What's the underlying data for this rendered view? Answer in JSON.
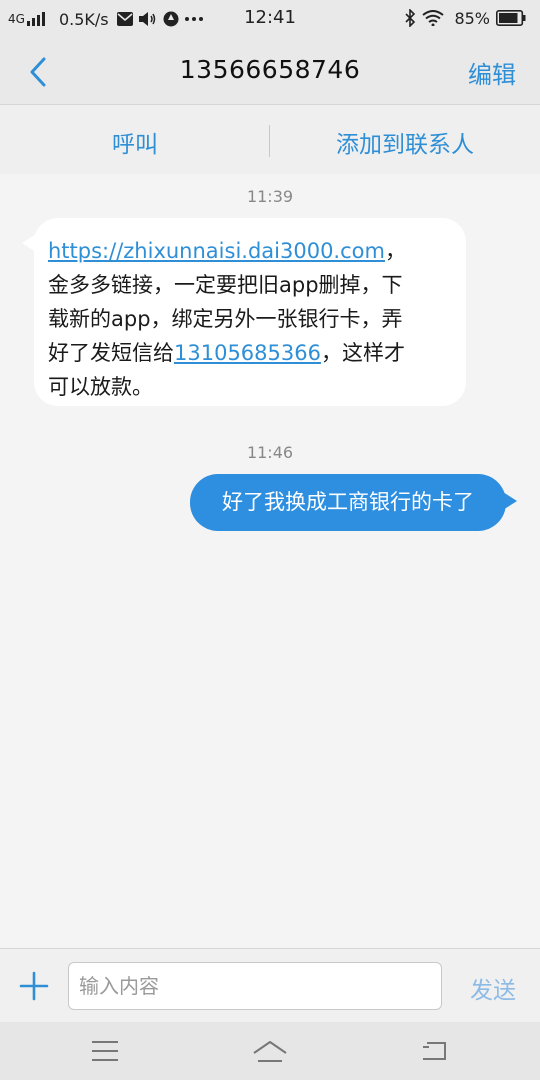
{
  "status_bar": {
    "network": "4G",
    "speed": "0.5K/s",
    "time": "12:41",
    "battery": "85%"
  },
  "header": {
    "title": "13566658746",
    "edit_label": "编辑"
  },
  "actions": {
    "call_label": "呼叫",
    "add_contact_label": "添加到联系人"
  },
  "messages": [
    {
      "timestamp": "11:39",
      "direction": "incoming",
      "link": "https://zhixunnaisi.dai3000.com",
      "line1_after_link": "，",
      "line2": "金多多链接，一定要把旧app删掉，下",
      "line3": "载新的app，绑定另外一张银行卡，弄",
      "line4_before_phone": "好了发短信给",
      "phone": "13105685366",
      "line4_after_phone": "，这样才",
      "line5": "可以放款。"
    },
    {
      "timestamp": "11:46",
      "direction": "outgoing",
      "text": "好了我换成工商银行的卡了"
    }
  ],
  "composer": {
    "placeholder": "输入内容",
    "send_label": "发送"
  },
  "colors": {
    "accent": "#2f8fd6",
    "outgoing_bubble": "#2e8fe0",
    "background": "#f4f4f4"
  }
}
